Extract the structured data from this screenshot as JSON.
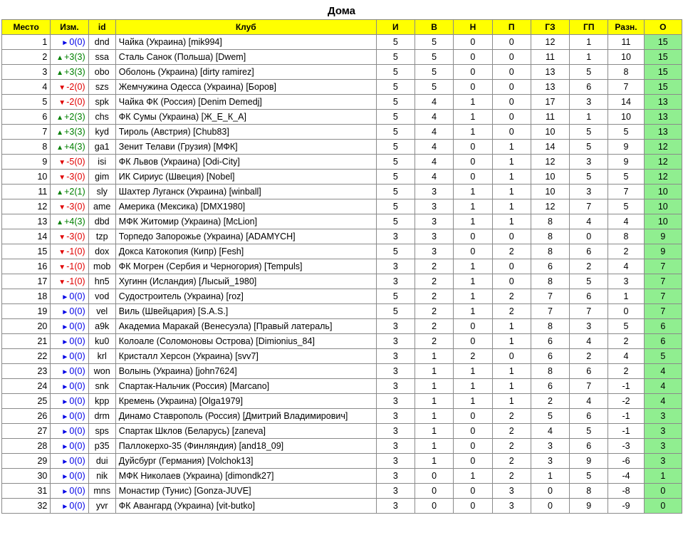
{
  "title": "Дома",
  "headers": [
    "Место",
    "Изм.",
    "id",
    "Клуб",
    "И",
    "В",
    "Н",
    "П",
    "ГЗ",
    "ГП",
    "Разн.",
    "О"
  ],
  "colors": {
    "header_bg": "#ffff00",
    "points_bg": "#90ee90",
    "up": "#008000",
    "down": "#e00000",
    "same": "#0000e6"
  },
  "rows": [
    {
      "place": "1",
      "dir": "same",
      "change": "0(0)",
      "id": "dnd",
      "club": "Чайка (Украина) [mik994]",
      "g": "5",
      "w": "5",
      "d": "0",
      "l": "0",
      "gf": "12",
      "ga": "1",
      "diff": "11",
      "pts": "15"
    },
    {
      "place": "2",
      "dir": "up",
      "change": "+3(3)",
      "id": "ssa",
      "club": "Сталь Санок (Польша) [Dwem]",
      "g": "5",
      "w": "5",
      "d": "0",
      "l": "0",
      "gf": "11",
      "ga": "1",
      "diff": "10",
      "pts": "15"
    },
    {
      "place": "3",
      "dir": "up",
      "change": "+3(3)",
      "id": "obo",
      "club": "Оболонь (Украина) [dirty ramirez]",
      "g": "5",
      "w": "5",
      "d": "0",
      "l": "0",
      "gf": "13",
      "ga": "5",
      "diff": "8",
      "pts": "15"
    },
    {
      "place": "4",
      "dir": "down",
      "change": "-2(0)",
      "id": "szs",
      "club": "Жемчужина Одесса (Украина) [Боров]",
      "g": "5",
      "w": "5",
      "d": "0",
      "l": "0",
      "gf": "13",
      "ga": "6",
      "diff": "7",
      "pts": "15"
    },
    {
      "place": "5",
      "dir": "down",
      "change": "-2(0)",
      "id": "spk",
      "club": "Чайка ФК (Россия) [Denim Demedj]",
      "g": "5",
      "w": "4",
      "d": "1",
      "l": "0",
      "gf": "17",
      "ga": "3",
      "diff": "14",
      "pts": "13"
    },
    {
      "place": "6",
      "dir": "up",
      "change": "+2(3)",
      "id": "chs",
      "club": "ФК Сумы (Украина) [Ж_Е_К_А]",
      "g": "5",
      "w": "4",
      "d": "1",
      "l": "0",
      "gf": "11",
      "ga": "1",
      "diff": "10",
      "pts": "13"
    },
    {
      "place": "7",
      "dir": "up",
      "change": "+3(3)",
      "id": "kyd",
      "club": "Тироль (Австрия) [Chub83]",
      "g": "5",
      "w": "4",
      "d": "1",
      "l": "0",
      "gf": "10",
      "ga": "5",
      "diff": "5",
      "pts": "13"
    },
    {
      "place": "8",
      "dir": "up",
      "change": "+4(3)",
      "id": "ga1",
      "club": "Зенит Телави (Грузия) [МФК]",
      "g": "5",
      "w": "4",
      "d": "0",
      "l": "1",
      "gf": "14",
      "ga": "5",
      "diff": "9",
      "pts": "12"
    },
    {
      "place": "9",
      "dir": "down",
      "change": "-5(0)",
      "id": "isi",
      "club": "ФК Львов (Украина) [Odi-City]",
      "g": "5",
      "w": "4",
      "d": "0",
      "l": "1",
      "gf": "12",
      "ga": "3",
      "diff": "9",
      "pts": "12"
    },
    {
      "place": "10",
      "dir": "down",
      "change": "-3(0)",
      "id": "gim",
      "club": "ИК Сириус (Швеция) [Nobel]",
      "g": "5",
      "w": "4",
      "d": "0",
      "l": "1",
      "gf": "10",
      "ga": "5",
      "diff": "5",
      "pts": "12"
    },
    {
      "place": "11",
      "dir": "up",
      "change": "+2(1)",
      "id": "sly",
      "club": "Шахтер Луганск (Украина) [winball]",
      "g": "5",
      "w": "3",
      "d": "1",
      "l": "1",
      "gf": "10",
      "ga": "3",
      "diff": "7",
      "pts": "10"
    },
    {
      "place": "12",
      "dir": "down",
      "change": "-3(0)",
      "id": "ame",
      "club": "Америка (Мексика) [DMX1980]",
      "g": "5",
      "w": "3",
      "d": "1",
      "l": "1",
      "gf": "12",
      "ga": "7",
      "diff": "5",
      "pts": "10"
    },
    {
      "place": "13",
      "dir": "up",
      "change": "+4(3)",
      "id": "dbd",
      "club": "МФК Житомир (Украина) [McLion]",
      "g": "5",
      "w": "3",
      "d": "1",
      "l": "1",
      "gf": "8",
      "ga": "4",
      "diff": "4",
      "pts": "10"
    },
    {
      "place": "14",
      "dir": "down",
      "change": "-3(0)",
      "id": "tzp",
      "club": "Торпедо Запорожье (Украина) [ADAMYCH]",
      "g": "3",
      "w": "3",
      "d": "0",
      "l": "0",
      "gf": "8",
      "ga": "0",
      "diff": "8",
      "pts": "9"
    },
    {
      "place": "15",
      "dir": "down",
      "change": "-1(0)",
      "id": "dox",
      "club": "Докса Катокопия (Кипр) [Fesh]",
      "g": "5",
      "w": "3",
      "d": "0",
      "l": "2",
      "gf": "8",
      "ga": "6",
      "diff": "2",
      "pts": "9"
    },
    {
      "place": "16",
      "dir": "down",
      "change": "-1(0)",
      "id": "mob",
      "club": "ФК Могрен (Сербия и Черногория) [Tempuls]",
      "g": "3",
      "w": "2",
      "d": "1",
      "l": "0",
      "gf": "6",
      "ga": "2",
      "diff": "4",
      "pts": "7"
    },
    {
      "place": "17",
      "dir": "down",
      "change": "-1(0)",
      "id": "hn5",
      "club": "Хугинн (Исландия) [Лысый_1980]",
      "g": "3",
      "w": "2",
      "d": "1",
      "l": "0",
      "gf": "8",
      "ga": "5",
      "diff": "3",
      "pts": "7"
    },
    {
      "place": "18",
      "dir": "same",
      "change": "0(0)",
      "id": "vod",
      "club": "Судостроитель (Украина) [roz]",
      "g": "5",
      "w": "2",
      "d": "1",
      "l": "2",
      "gf": "7",
      "ga": "6",
      "diff": "1",
      "pts": "7"
    },
    {
      "place": "19",
      "dir": "same",
      "change": "0(0)",
      "id": "vel",
      "club": "Виль (Швейцария) [S.A.S.]",
      "g": "5",
      "w": "2",
      "d": "1",
      "l": "2",
      "gf": "7",
      "ga": "7",
      "diff": "0",
      "pts": "7"
    },
    {
      "place": "20",
      "dir": "same",
      "change": "0(0)",
      "id": "a9k",
      "club": "Академиа Маракай (Венесуэла) [Правый латераль]",
      "g": "3",
      "w": "2",
      "d": "0",
      "l": "1",
      "gf": "8",
      "ga": "3",
      "diff": "5",
      "pts": "6"
    },
    {
      "place": "21",
      "dir": "same",
      "change": "0(0)",
      "id": "ku0",
      "club": "Колоале (Соломоновы Острова) [Dimionius_84]",
      "g": "3",
      "w": "2",
      "d": "0",
      "l": "1",
      "gf": "6",
      "ga": "4",
      "diff": "2",
      "pts": "6"
    },
    {
      "place": "22",
      "dir": "same",
      "change": "0(0)",
      "id": "krl",
      "club": "Кристалл Херсон (Украина) [svv7]",
      "g": "3",
      "w": "1",
      "d": "2",
      "l": "0",
      "gf": "6",
      "ga": "2",
      "diff": "4",
      "pts": "5"
    },
    {
      "place": "23",
      "dir": "same",
      "change": "0(0)",
      "id": "won",
      "club": "Волынь (Украина) [john7624]",
      "g": "3",
      "w": "1",
      "d": "1",
      "l": "1",
      "gf": "8",
      "ga": "6",
      "diff": "2",
      "pts": "4"
    },
    {
      "place": "24",
      "dir": "same",
      "change": "0(0)",
      "id": "snk",
      "club": "Спартак-Нальчик (Россия) [Marcano]",
      "g": "3",
      "w": "1",
      "d": "1",
      "l": "1",
      "gf": "6",
      "ga": "7",
      "diff": "-1",
      "pts": "4"
    },
    {
      "place": "25",
      "dir": "same",
      "change": "0(0)",
      "id": "kpp",
      "club": "Кремень (Украина) [Olga1979]",
      "g": "3",
      "w": "1",
      "d": "1",
      "l": "1",
      "gf": "2",
      "ga": "4",
      "diff": "-2",
      "pts": "4"
    },
    {
      "place": "26",
      "dir": "same",
      "change": "0(0)",
      "id": "drm",
      "club": "Динамо Ставрополь (Россия) [Дмитрий Владимирович]",
      "g": "3",
      "w": "1",
      "d": "0",
      "l": "2",
      "gf": "5",
      "ga": "6",
      "diff": "-1",
      "pts": "3"
    },
    {
      "place": "27",
      "dir": "same",
      "change": "0(0)",
      "id": "sps",
      "club": "Спартак Шклов (Беларусь) [zaneva]",
      "g": "3",
      "w": "1",
      "d": "0",
      "l": "2",
      "gf": "4",
      "ga": "5",
      "diff": "-1",
      "pts": "3"
    },
    {
      "place": "28",
      "dir": "same",
      "change": "0(0)",
      "id": "p35",
      "club": "Паллокерхо-35 (Финляндия) [and18_09]",
      "g": "3",
      "w": "1",
      "d": "0",
      "l": "2",
      "gf": "3",
      "ga": "6",
      "diff": "-3",
      "pts": "3"
    },
    {
      "place": "29",
      "dir": "same",
      "change": "0(0)",
      "id": "dui",
      "club": "Дуйсбург (Германия) [Volchok13]",
      "g": "3",
      "w": "1",
      "d": "0",
      "l": "2",
      "gf": "3",
      "ga": "9",
      "diff": "-6",
      "pts": "3"
    },
    {
      "place": "30",
      "dir": "same",
      "change": "0(0)",
      "id": "nik",
      "club": "МФК Николаев (Украина) [dimondk27]",
      "g": "3",
      "w": "0",
      "d": "1",
      "l": "2",
      "gf": "1",
      "ga": "5",
      "diff": "-4",
      "pts": "1"
    },
    {
      "place": "31",
      "dir": "same",
      "change": "0(0)",
      "id": "mns",
      "club": "Монастир (Тунис) [Gonza-JUVE]",
      "g": "3",
      "w": "0",
      "d": "0",
      "l": "3",
      "gf": "0",
      "ga": "8",
      "diff": "-8",
      "pts": "0"
    },
    {
      "place": "32",
      "dir": "same",
      "change": "0(0)",
      "id": "yvr",
      "club": "ФК Авангард (Украина) [vit-butko]",
      "g": "3",
      "w": "0",
      "d": "0",
      "l": "3",
      "gf": "0",
      "ga": "9",
      "diff": "-9",
      "pts": "0"
    }
  ]
}
